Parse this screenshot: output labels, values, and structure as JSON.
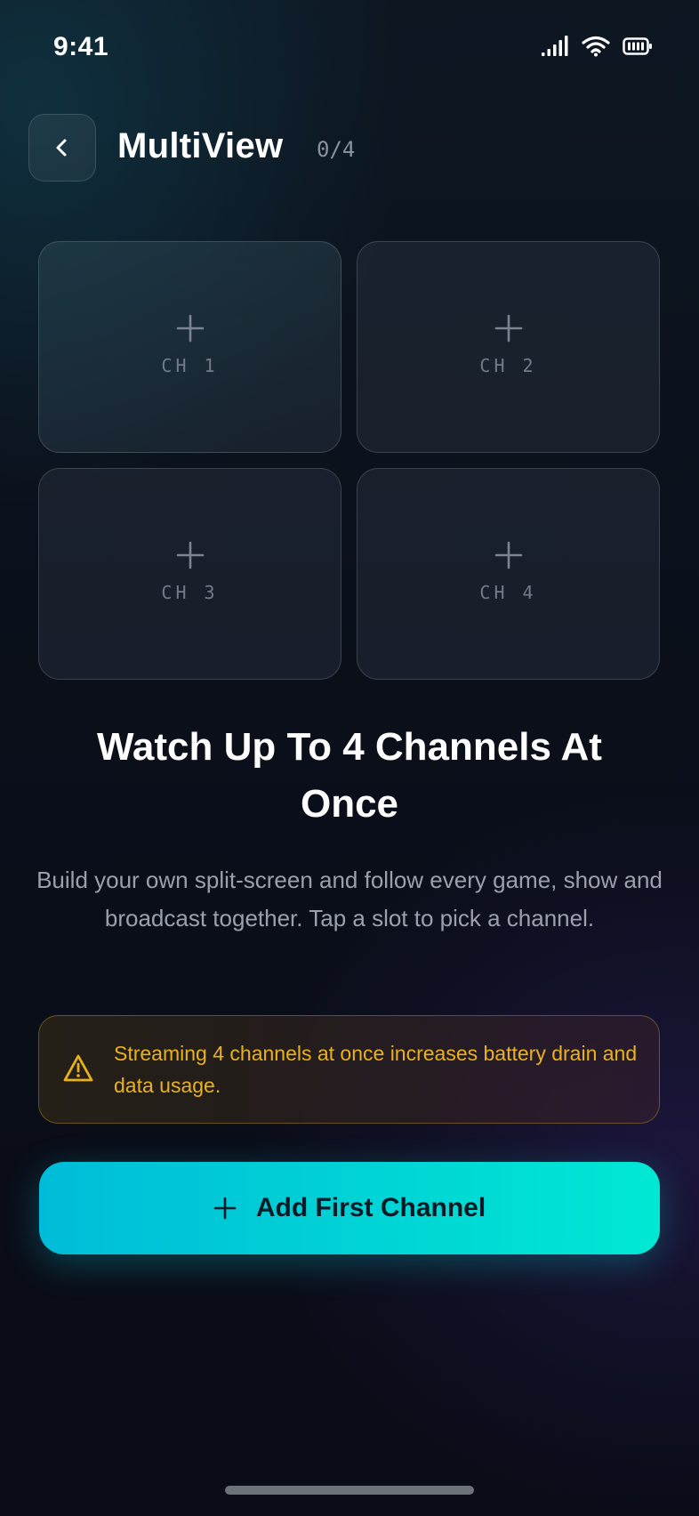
{
  "status_bar": {
    "time": "9:41",
    "icons": [
      "cellular-signal-icon",
      "wifi-icon",
      "battery-icon"
    ]
  },
  "header": {
    "back_icon": "chevron-left-icon",
    "title": "MultiView",
    "slot_count": "0/4"
  },
  "slots": [
    {
      "label": "CH 1",
      "icon": "plus-icon"
    },
    {
      "label": "CH 2",
      "icon": "plus-icon"
    },
    {
      "label": "CH 3",
      "icon": "plus-icon"
    },
    {
      "label": "CH 4",
      "icon": "plus-icon"
    }
  ],
  "hero": {
    "headline": "Watch Up To 4 Channels At Once",
    "description": "Build your own split-screen and follow every game, show and broadcast together. Tap a slot to pick a channel."
  },
  "warning": {
    "icon": "warning-triangle-icon",
    "text": "Streaming 4 channels at once increases battery drain and data usage."
  },
  "primary_action": {
    "icon": "plus-icon",
    "label": "Add First Channel"
  },
  "colors": {
    "accent_start": "#00bcd8",
    "accent_end": "#00e8d4",
    "warning": "#e9b21c"
  }
}
